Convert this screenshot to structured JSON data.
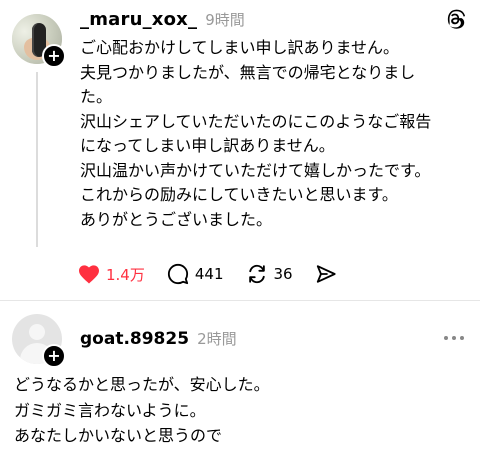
{
  "post": {
    "username": "_maru_xox_",
    "time": "9時間",
    "lines": [
      "ご心配おかけしてしまい申し訳ありません。",
      "夫見つかりましたが、無言での帰宅となりまし",
      "た。",
      "沢山シェアしていただいたのにこのようなご報告",
      "になってしまい申し訳ありません。",
      "沢山温かい声かけていただけて嬉しかったです。",
      "これからの励みにしていきたいと思います。",
      "ありがとうございました。"
    ],
    "likes": "1.4万",
    "comments": "441",
    "reposts": "36",
    "icons": {
      "like": "heart-filled-icon",
      "comment": "comment-bubble-icon",
      "repost": "repost-icon",
      "share": "send-icon",
      "brand": "threads-logo-icon"
    }
  },
  "reply": {
    "username": "goat.89825",
    "time": "2時間",
    "lines": [
      "どうなるかと思ったが、安心した。",
      "ガミガミ言わないように。",
      "あなたしかいないと思うので"
    ],
    "icons": {
      "more": "more-horizontal-icon"
    }
  },
  "colors": {
    "like": "#ff3040",
    "muted": "#999999",
    "line": "#dcdcdc"
  },
  "badge": "+"
}
